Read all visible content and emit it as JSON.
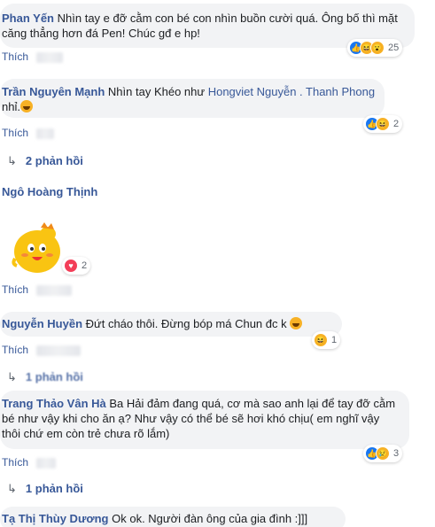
{
  "action_like": "Thích",
  "comments": [
    {
      "author": "Phan Yến",
      "text": "Nhìn tay e đỡ cằm con bé con nhìn buồn cười quá. Ông bố thì mặt căng thẳng hơn đá Pen! Chúc gđ e hp!",
      "reactions": [
        "like-icon",
        "haha-icon",
        "wow-icon"
      ],
      "reaction_count": "25"
    },
    {
      "author": "Trần Nguyên Mạnh",
      "text_before": "Nhìn tay Khéo như ",
      "mention": "Hongviet Nguyễn . Thanh Phong",
      "text_after": " nhỉ.",
      "reactions": [
        "like-icon",
        "haha-icon"
      ],
      "reaction_count": "2",
      "replies": "2 phản hồi"
    },
    {
      "author": "Ngô Hoàng Thịnh",
      "reactions": [
        "love-icon"
      ],
      "reaction_count": "2"
    },
    {
      "author": "Nguyễn Huyền",
      "text": "Đứt cháo thôi. Đừng bóp má Chun đc k",
      "reactions": [
        "haha-icon"
      ],
      "reaction_count": "1",
      "replies": "1 phản hồi"
    },
    {
      "author": "Trang Thảo Vân Hà",
      "text": "Ba Hải đảm đang quá, cơ mà sao anh lại để tay đỡ cằm bé như vậy khi cho ăn ạ? Như vậy có thể bé sẽ hơi khó chịu( em nghĩ vậy thôi chứ em còn trẻ chưa rõ lắm)",
      "reactions": [
        "like-icon",
        "sad-icon"
      ],
      "reaction_count": "3",
      "replies": "1 phản hồi"
    },
    {
      "author": "Tạ Thị Thùy Dương",
      "text": "Ok ok. Người đàn ông của gia đình :]]]"
    }
  ]
}
